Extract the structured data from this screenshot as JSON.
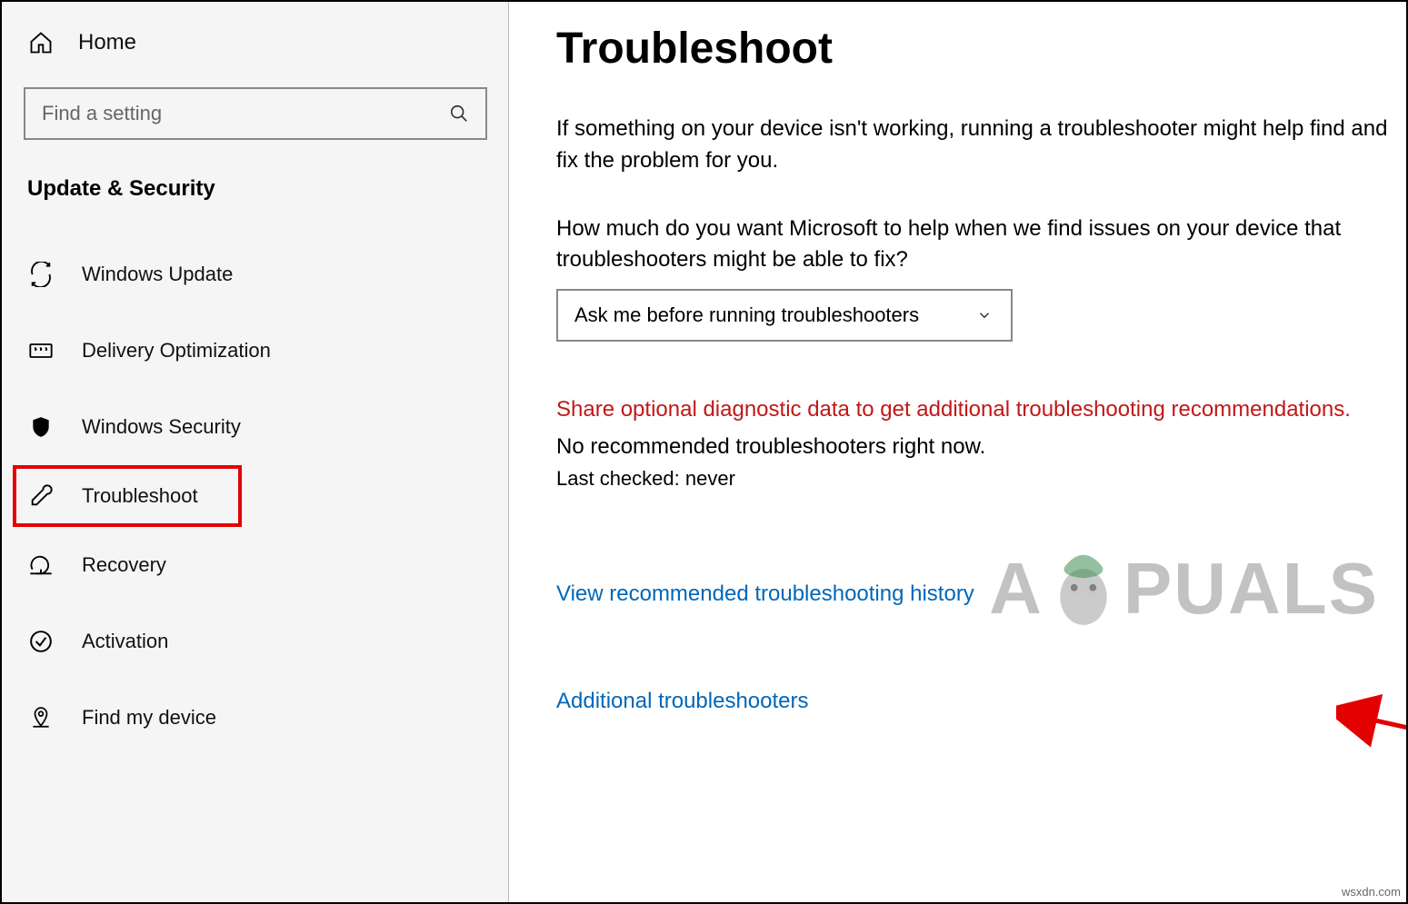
{
  "sidebar": {
    "home": "Home",
    "search_placeholder": "Find a setting",
    "category": "Update & Security",
    "items": [
      {
        "label": "Windows Update"
      },
      {
        "label": "Delivery Optimization"
      },
      {
        "label": "Windows Security"
      },
      {
        "label": "Troubleshoot"
      },
      {
        "label": "Recovery"
      },
      {
        "label": "Activation"
      },
      {
        "label": "Find my device"
      }
    ]
  },
  "main": {
    "title": "Troubleshoot",
    "intro": "If something on your device isn't working, running a troubleshooter might help find and fix the problem for you.",
    "question": "How much do you want Microsoft to help when we find issues on your device that troubleshooters might be able to fix?",
    "dropdown_value": "Ask me before running troubleshooters",
    "red_notice": "Share optional diagnostic data to get additional troubleshooting recommendations.",
    "no_recommended": "No recommended troubleshooters right now.",
    "last_checked": "Last checked: never",
    "link_history": "View recommended troubleshooting history",
    "link_additional": "Additional troubleshooters"
  },
  "watermark": {
    "a": "A",
    "rest": "PUALS"
  },
  "source": "wsxdn.com"
}
